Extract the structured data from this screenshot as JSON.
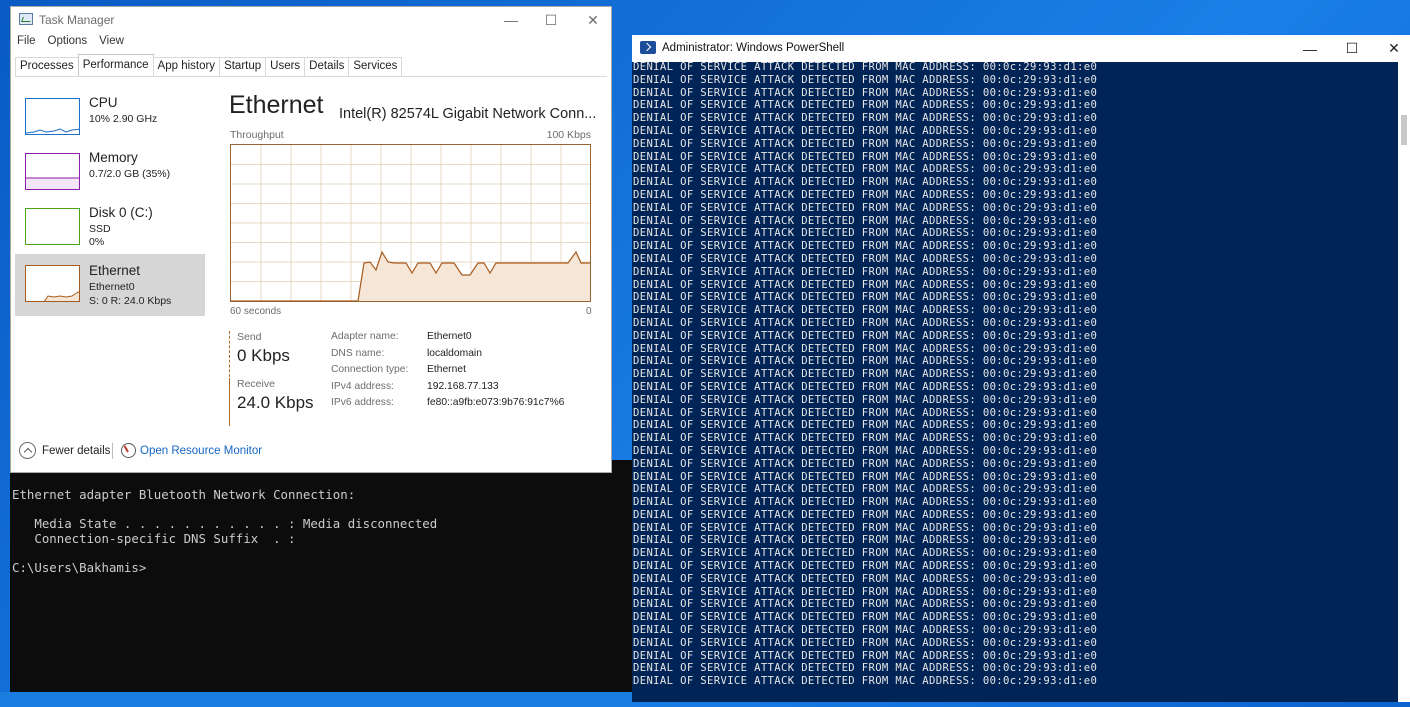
{
  "task_manager": {
    "title": "Task Manager",
    "controls": {
      "minimize": "—",
      "maximize": "☐",
      "close": "✕"
    },
    "menu": [
      "File",
      "Options",
      "View"
    ],
    "tabs": [
      "Processes",
      "Performance",
      "App history",
      "Startup",
      "Users",
      "Details",
      "Services"
    ],
    "active_tab": "Performance",
    "sidebar": [
      {
        "title": "CPU",
        "sub1": "10% 2.90 GHz",
        "sub2": "",
        "sub3": "",
        "color": "#1a6fc9"
      },
      {
        "title": "Memory",
        "sub1": "0.7/2.0 GB (35%)",
        "sub2": "",
        "sub3": "",
        "color": "#8b1ea8"
      },
      {
        "title": "Disk 0 (C:)",
        "sub1": "SSD",
        "sub2": "0%",
        "sub3": "",
        "color": "#4ba614"
      },
      {
        "title": "Ethernet",
        "sub1": "Ethernet0",
        "sub2": "S: 0 R: 24.0 Kbps",
        "sub3": "",
        "color": "#a75a1d"
      }
    ],
    "main": {
      "heading": "Ethernet",
      "adapter": "Intel(R) 82574L Gigabit Network Conn...",
      "throughput_label": "Throughput",
      "max_scale": "100 Kbps",
      "x_left": "60 seconds",
      "x_right": "0",
      "send_label": "Send",
      "send_value": "0 Kbps",
      "receive_label": "Receive",
      "receive_value": "24.0 Kbps",
      "details": [
        {
          "key": "Adapter name:",
          "value": "Ethernet0"
        },
        {
          "key": "DNS name:",
          "value": "localdomain"
        },
        {
          "key": "Connection type:",
          "value": "Ethernet"
        },
        {
          "key": "IPv4 address:",
          "value": "192.168.77.133"
        },
        {
          "key": "IPv6 address:",
          "value": "fe80::a9fb:e073:9b76:91c7%6"
        }
      ]
    },
    "footer": {
      "fewer_details": "Fewer details",
      "open_resource_monitor": "Open Resource Monitor"
    }
  },
  "cmd": {
    "line1": "Ethernet adapter Bluetooth Network Connection:",
    "line2": "   Media State . . . . . . . . . . . : Media disconnected",
    "line3": "   Connection-specific DNS Suffix  . :",
    "line4": "C:\\Users\\Bakhamis>"
  },
  "powershell": {
    "title": "Administrator: Windows PowerShell",
    "controls": {
      "minimize": "—",
      "maximize": "☐",
      "close": "✕"
    },
    "output_line": "DENIAL OF SERVICE ATTACK DETECTED FROM MAC ADDRESS: 00:0c:29:93:d1:e0",
    "line_count": 49
  },
  "colors": {
    "ethernet_accent": "#a75a1d",
    "powershell_bg": "#012456",
    "desktop_blue": "#0b6ad8"
  }
}
